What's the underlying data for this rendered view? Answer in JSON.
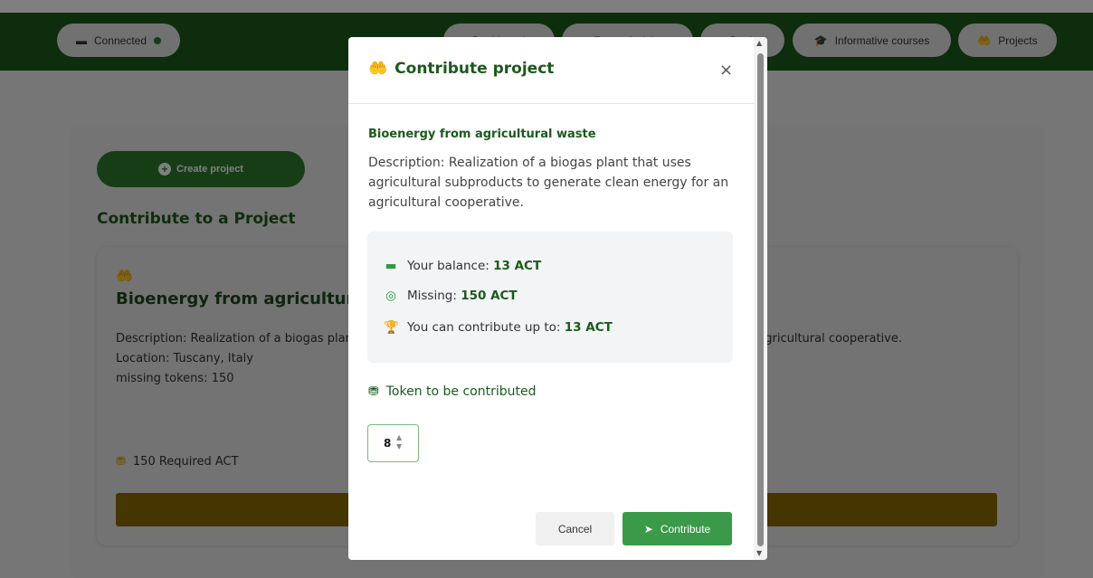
{
  "nav": {
    "status_label": "Connected",
    "items": [
      "Dashboard",
      "Forest Activity",
      "Bank",
      "Informative courses",
      "Projects"
    ]
  },
  "page": {
    "create_button": "Create project",
    "section_title": "Contribute to a Project",
    "project": {
      "title": "Bioenergy from agricultural waste",
      "description": "Description: Realization of a biogas plant that uses agricultural subproducts to generate clean energy for an agricultural cooperative.",
      "location": "Location: Tuscany, Italy",
      "missing": "missing tokens: 150",
      "required": "150 Required ACT"
    }
  },
  "modal": {
    "title": "Contribute project",
    "close": "×",
    "project_title": "Bioenergy from agricultural waste",
    "description": "Description: Realization of a biogas plant that uses agricultural subproducts to generate clean energy for an agricultural cooperative.",
    "balance_label": "Your balance:",
    "balance_value": "13 ACT",
    "missing_label": "Missing:",
    "missing_value": "150 ACT",
    "max_label": "You can contribute up to:",
    "max_value": "13 ACT",
    "token_label": "Token to be contributed",
    "token_value": "8",
    "cancel": "Cancel",
    "contribute": "Contribute"
  },
  "colors": {
    "brand_green": "#1a5a1a",
    "accent_green": "#3a9a4a",
    "bar_gold": "#8a6a00"
  }
}
